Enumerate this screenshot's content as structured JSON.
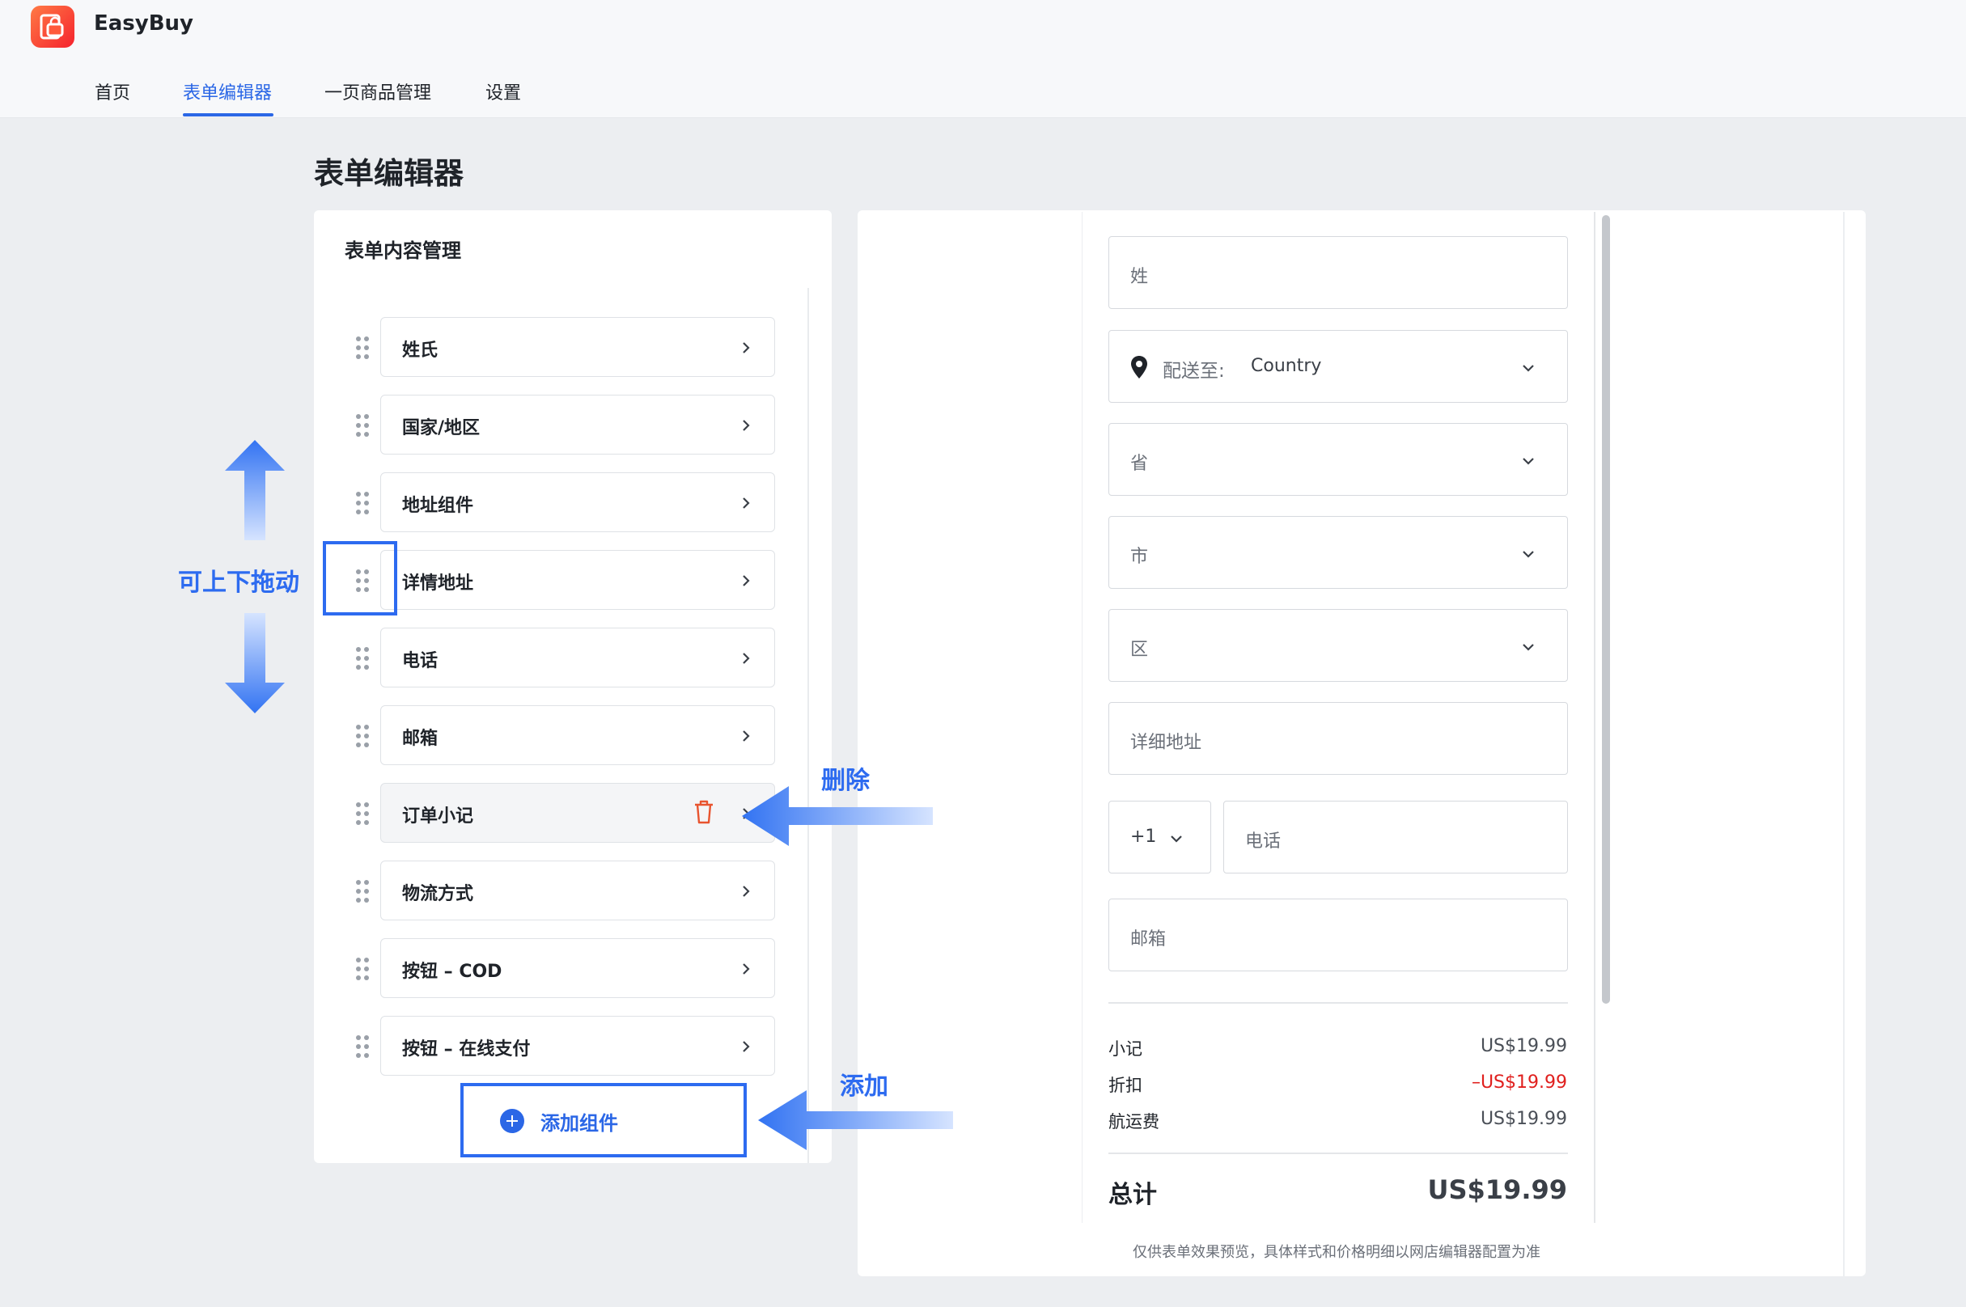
{
  "app": {
    "name": "EasyBuy",
    "logo_icon": "document-bag-icon"
  },
  "nav": {
    "items": [
      {
        "label": "首页"
      },
      {
        "label": "表单编辑器",
        "active": true
      },
      {
        "label": "一页商品管理"
      },
      {
        "label": "设置"
      }
    ]
  },
  "page": {
    "title": "表单编辑器"
  },
  "editor": {
    "header": "表单内容管理",
    "items": [
      {
        "label": "姓氏"
      },
      {
        "label": "国家/地区"
      },
      {
        "label": "地址组件"
      },
      {
        "label": "详情地址"
      },
      {
        "label": "电话"
      },
      {
        "label": "邮箱"
      },
      {
        "label": "订单小记",
        "hovered": true,
        "delete_icon": "trash-icon"
      },
      {
        "label": "物流方式"
      },
      {
        "label": "按钮 – COD"
      },
      {
        "label": "按钮 – 在线支付"
      }
    ],
    "add_button": "添加组件"
  },
  "annotations": {
    "drag": "可上下拖动",
    "delete": "删除",
    "add": "添加"
  },
  "preview": {
    "last_name": "姓",
    "shipping_prefix": "配送至:",
    "country_placeholder": "Country",
    "province": "省",
    "city": "市",
    "district": "区",
    "address": "详细地址",
    "phone_code": "+1",
    "phone": "电话",
    "email": "邮箱",
    "summary": {
      "subtotal_label": "小记",
      "subtotal": "US$19.99",
      "discount_label": "折扣",
      "discount": "–US$19.99",
      "shipping_label": "航运费",
      "shipping": "US$19.99",
      "total_label": "总计",
      "total": "US$19.99"
    },
    "note": "仅供表单效果预览，具体样式和价格明细以网店编辑器配置为准"
  },
  "colors": {
    "accent": "#2b67e6",
    "annotation": "#2d6bf0",
    "discount": "#e0201e",
    "delete": "#e8542f"
  }
}
